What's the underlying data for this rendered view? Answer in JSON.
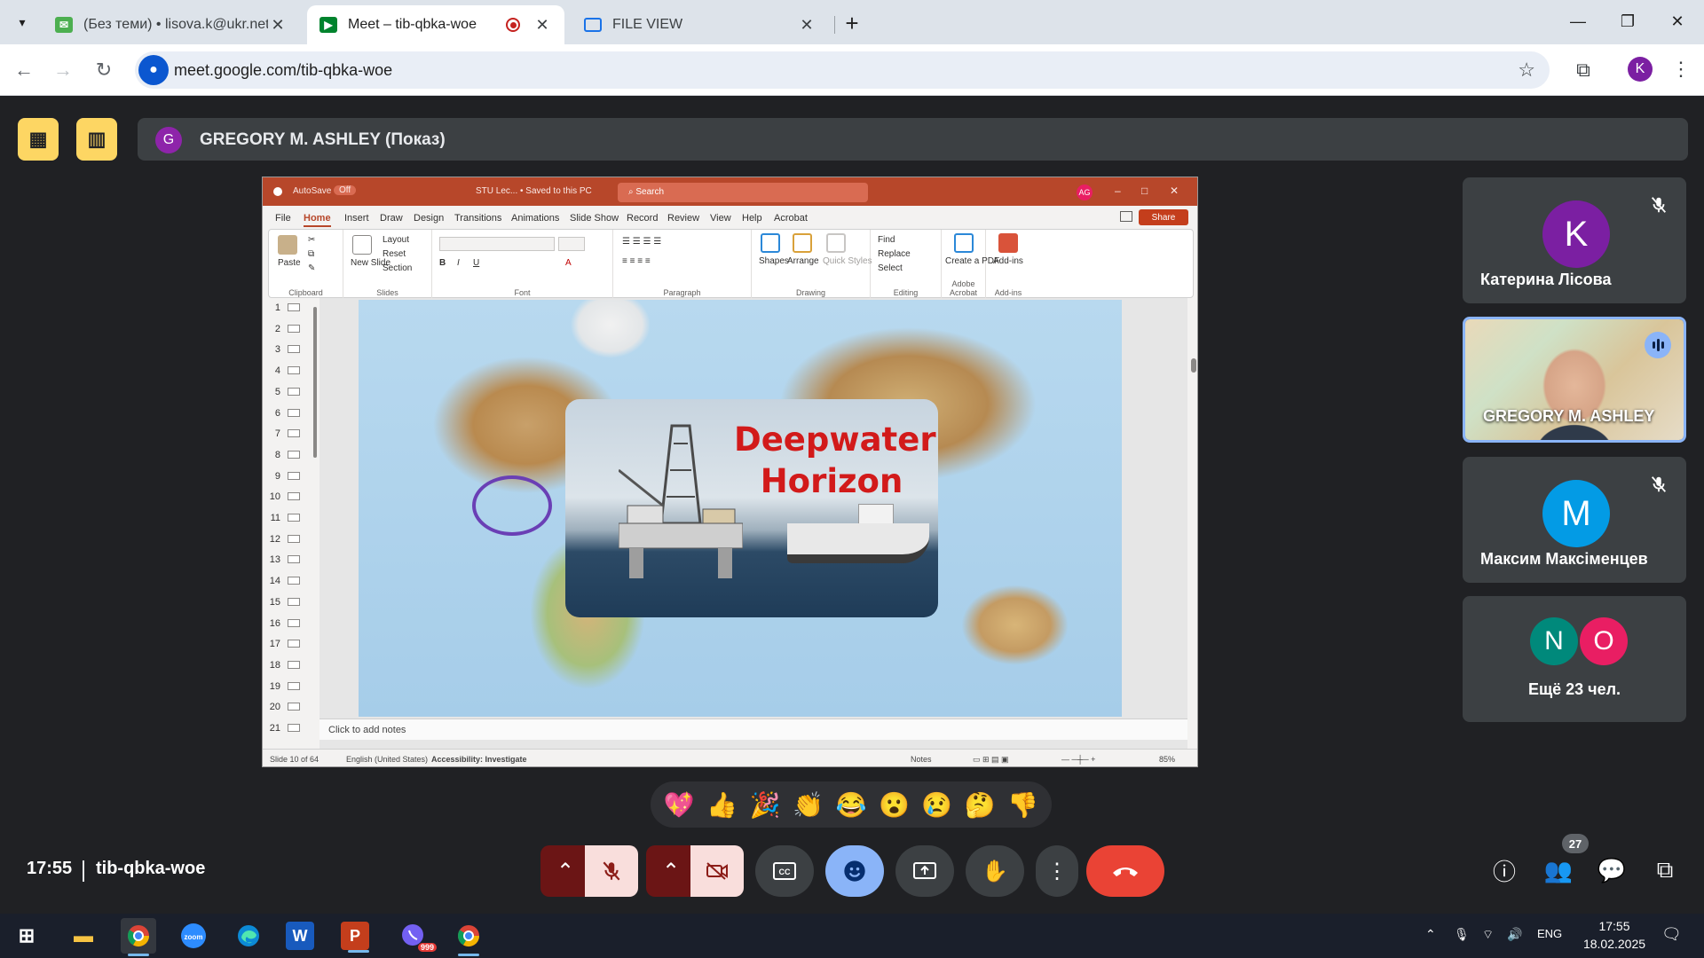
{
  "browser": {
    "tabs": [
      {
        "title": "(Без теми) • lisova.k@ukr.net",
        "icon": "ukr-net-mail-icon"
      },
      {
        "title": "Meet – tib-qbka-woe",
        "icon": "google-meet-icon",
        "active": true,
        "recording": true
      },
      {
        "title": "FILE VIEW",
        "icon": "file-view-icon"
      }
    ],
    "url": "meet.google.com/tib-qbka-woe",
    "profile_initial": "K"
  },
  "meet": {
    "presenter": {
      "avatar_initial": "G",
      "label": "GREGORY M. ASHLEY (Показ)"
    },
    "participants": [
      {
        "name": "Катерина Лісова",
        "initial": "K",
        "color": "#7b1fa2",
        "muted": true
      },
      {
        "name": "GREGORY M. ASHLEY",
        "video": true,
        "speaking": true
      },
      {
        "name": "Максим Максіменцев",
        "initial": "M",
        "color": "#039be5",
        "muted": true
      }
    ],
    "others": {
      "initials": [
        "N",
        "O"
      ],
      "colors": [
        "#00897b",
        "#e91e63"
      ],
      "label": "Ещё 23 чел."
    },
    "reactions": [
      "💖",
      "👍",
      "🎉",
      "👏",
      "😂",
      "😮",
      "😢",
      "🤔",
      "👎"
    ],
    "clock": "17:55",
    "meeting_code": "tib-qbka-woe",
    "people_count": "27",
    "accent": "#8ab4f8",
    "end_call_color": "#ea4335"
  },
  "ppt": {
    "title_autosave": "AutoSave",
    "title_autosave_state": "Off",
    "title_doc": "STU Lec... • Saved to this PC",
    "search_placeholder": "Search",
    "avatar": "AG",
    "tabs": [
      "File",
      "Home",
      "Insert",
      "Draw",
      "Design",
      "Transitions",
      "Animations",
      "Slide Show",
      "Record",
      "Review",
      "View",
      "Help",
      "Acrobat"
    ],
    "share": "Share",
    "ribbon": {
      "paste": "Paste",
      "clipboard": "Clipboard",
      "new_slide": "New Slide",
      "layout": "Layout",
      "reset": "Reset",
      "section": "Section",
      "slides": "Slides",
      "font": "Font",
      "paragraph": "Paragraph",
      "shapes": "Shapes",
      "arrange": "Arrange",
      "quick_styles": "Quick Styles",
      "drawing": "Drawing",
      "find": "Find",
      "replace": "Replace",
      "select": "Select",
      "editing": "Editing",
      "create_pdf": "Create a PDF",
      "adobe_acrobat": "Adobe Acrobat",
      "add_ins": "Add-ins",
      "add_ins_group": "Add-ins"
    },
    "slide_numbers": [
      "1",
      "2",
      "3",
      "4",
      "5",
      "6",
      "7",
      "8",
      "9",
      "10",
      "11",
      "12",
      "13",
      "14",
      "15",
      "16",
      "17",
      "18",
      "19",
      "20",
      "21"
    ],
    "slide_headline_1": "Deepwater",
    "slide_headline_2": "Horizon",
    "notes_placeholder": "Click to add notes",
    "status": {
      "slide": "Slide 10 of 64",
      "language": "English (United States)",
      "accessibility": "Accessibility: Investigate",
      "notes": "Notes",
      "zoom": "85%"
    }
  },
  "taskbar": {
    "clock_time": "17:55",
    "clock_date": "18.02.2025",
    "lang": "ENG",
    "viber_badge": "999"
  }
}
